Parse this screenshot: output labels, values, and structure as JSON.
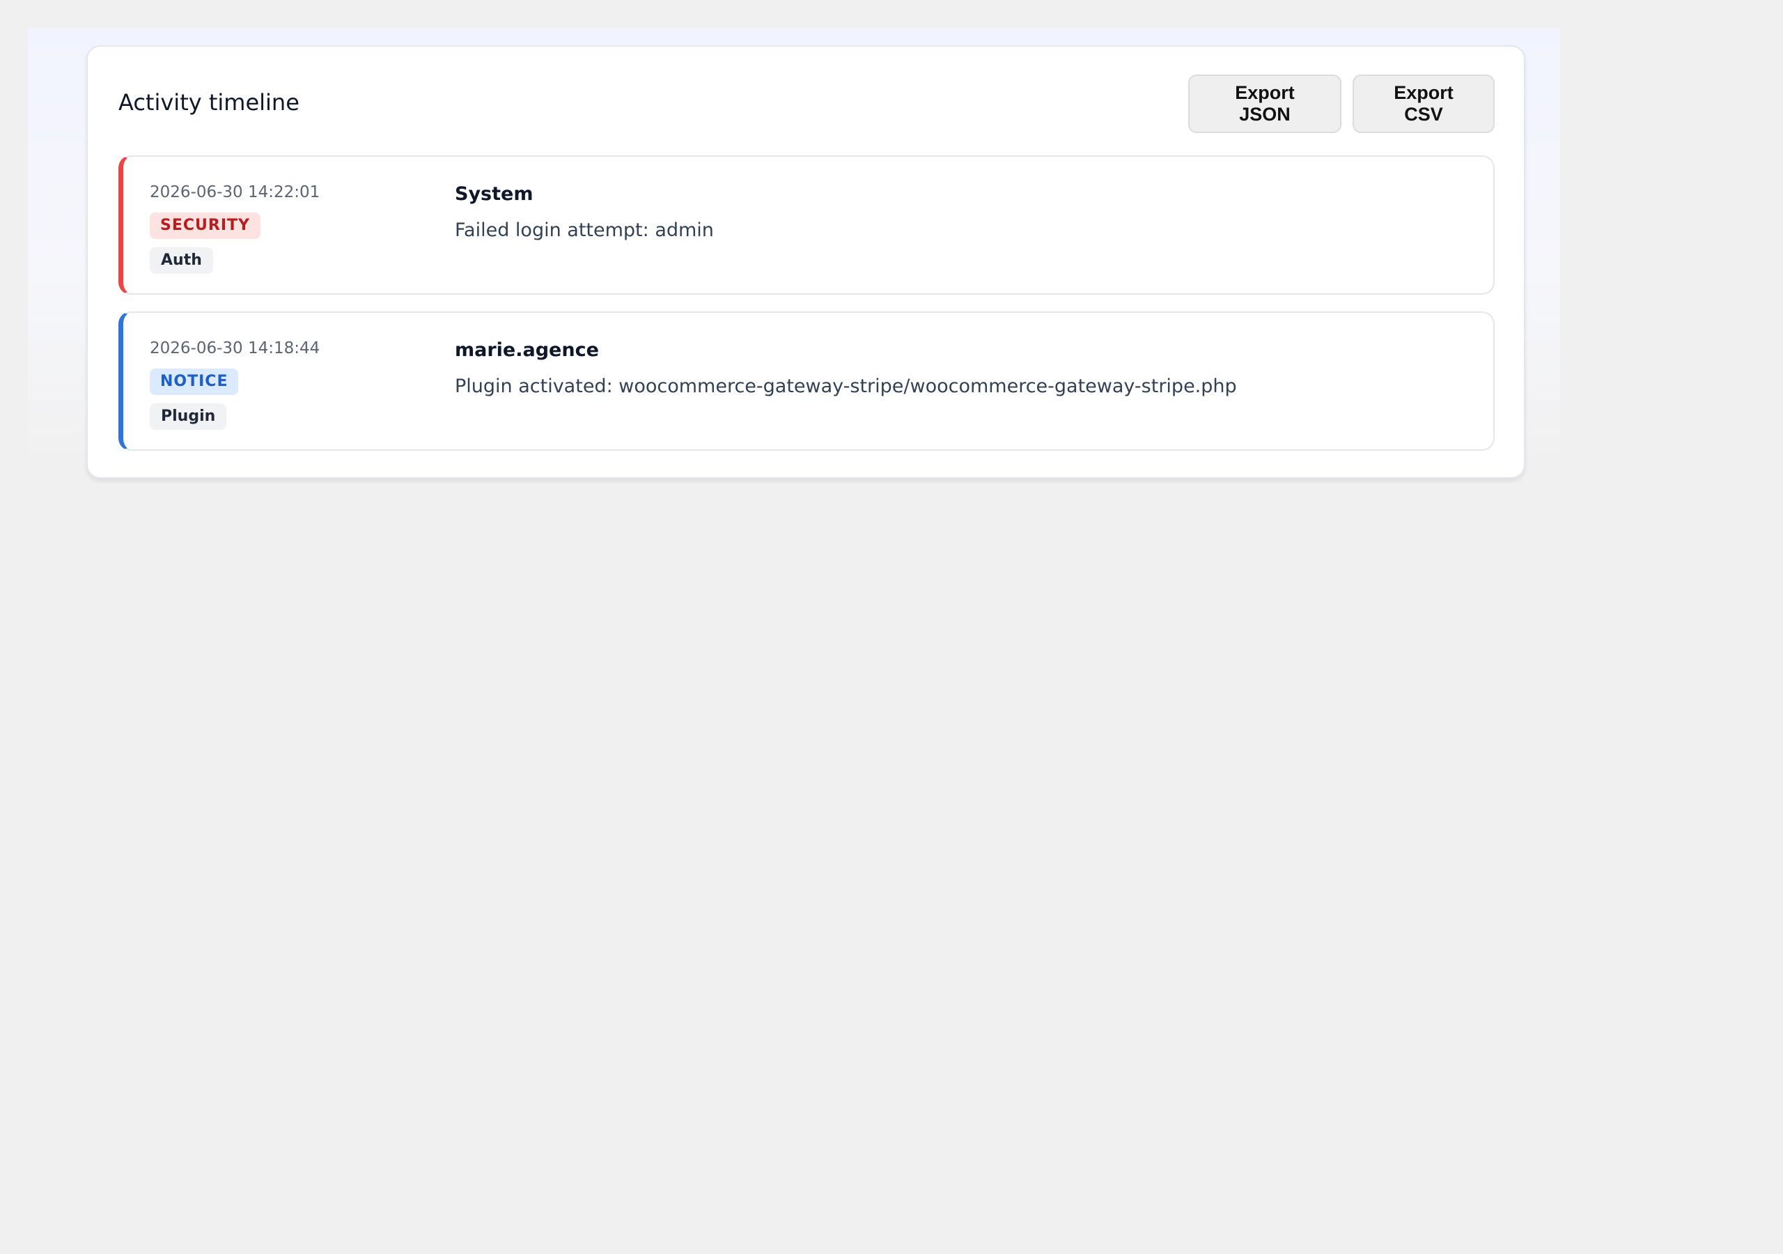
{
  "panel": {
    "title": "Activity timeline",
    "export_json_label": "Export JSON",
    "export_csv_label": "Export CSV"
  },
  "entries": [
    {
      "timestamp": "2026-06-30 14:22:01",
      "level": "SECURITY",
      "category": "Auth",
      "actor": "System",
      "message": "Failed login attempt: admin"
    },
    {
      "timestamp": "2026-06-30 14:18:44",
      "level": "NOTICE",
      "category": "Plugin",
      "actor": "marie.agence",
      "message": "Plugin activated: woocommerce-gateway-stripe/woocommerce-gateway-stripe.php"
    }
  ],
  "colors": {
    "security_accent": "#ef4444",
    "notice_accent": "#2f74d9",
    "security_badge_bg": "#fde2e2",
    "security_badge_text": "#b91c1c",
    "notice_badge_bg": "#dbeafe",
    "notice_badge_text": "#1d5fc7"
  }
}
